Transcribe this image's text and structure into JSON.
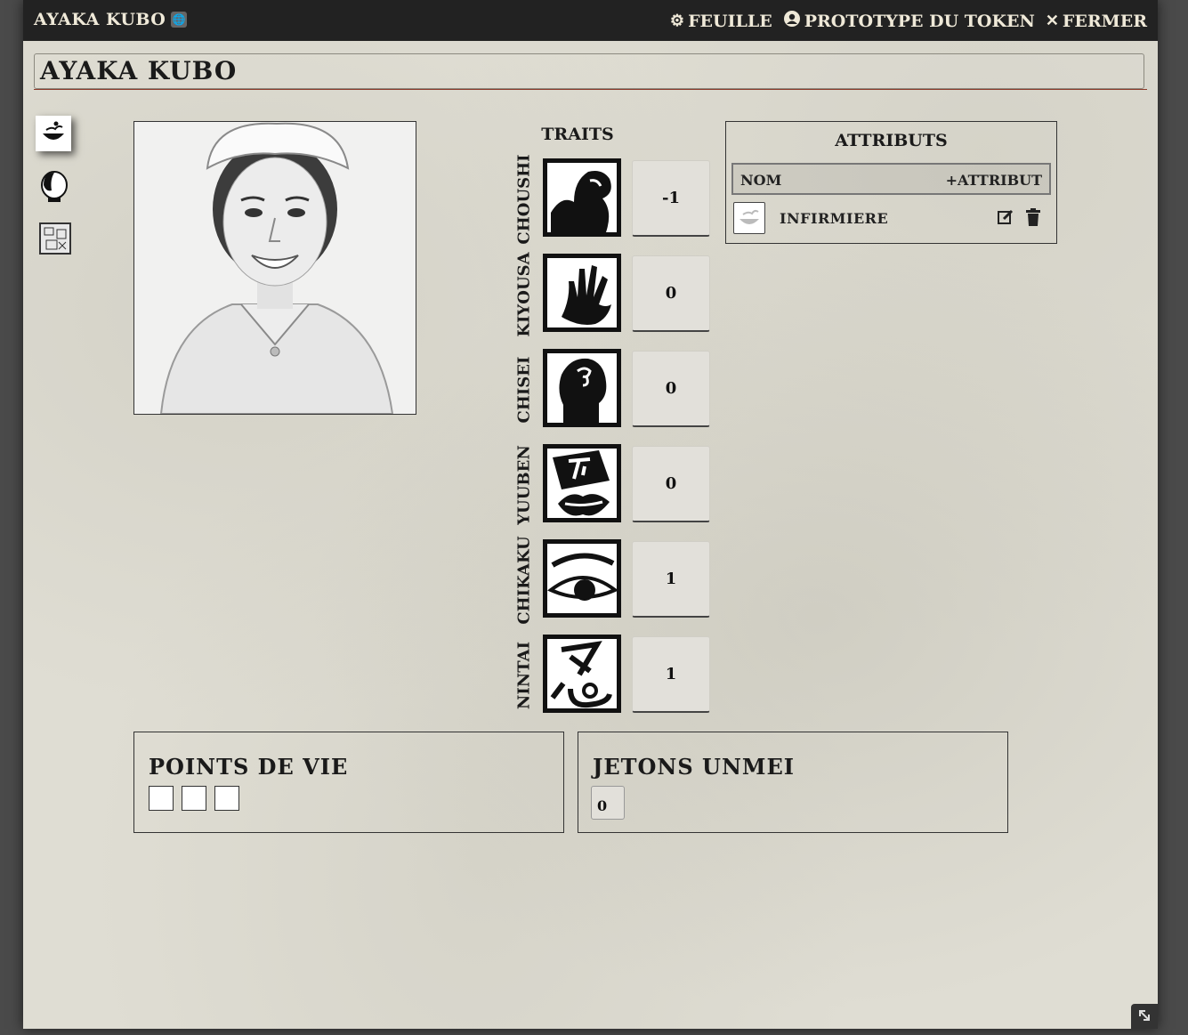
{
  "window": {
    "title": "AYAKA KUBO",
    "actions": [
      {
        "label": "FEUILLE",
        "icon": "gear-icon"
      },
      {
        "label": "PROTOTYPE DU TOKEN",
        "icon": "user-circle-icon"
      },
      {
        "label": "FERMER",
        "icon": "close-icon"
      }
    ]
  },
  "sheet": {
    "name": "AYAKA KUBO",
    "tabs": [
      {
        "icon": "bowl-icon",
        "active": true
      },
      {
        "icon": "mask-icon",
        "active": false
      },
      {
        "icon": "scroll-icon",
        "active": false
      }
    ]
  },
  "traits": {
    "title": "TRAITS",
    "items": [
      {
        "label": "CHOUSHI",
        "value": "-1",
        "icon": "arm-icon"
      },
      {
        "label": "KIYOUSA",
        "value": "0",
        "icon": "hand-icon"
      },
      {
        "label": "CHISEI",
        "value": "0",
        "icon": "head-icon"
      },
      {
        "label": "YUUBEN",
        "value": "0",
        "icon": "mouth-icon"
      },
      {
        "label": "CHIKAKU",
        "value": "1",
        "icon": "eye-icon"
      },
      {
        "label": "NINTAI",
        "value": "1",
        "icon": "kanji-icon"
      }
    ]
  },
  "attributes": {
    "title": "ATTRIBUTS",
    "column": "NOM",
    "add_label": "+ATTRIBUT",
    "items": [
      {
        "name": "INFIRMIERE",
        "icon": "bowl-icon"
      }
    ]
  },
  "health": {
    "title": "POINTS DE VIE",
    "boxes": 3
  },
  "tokens": {
    "title": "JETONS UNMEI",
    "value": "0"
  },
  "colors": {
    "titlebar": "#222222",
    "accent_line": "#8b3a2a",
    "parchment": "#dfddd3"
  }
}
